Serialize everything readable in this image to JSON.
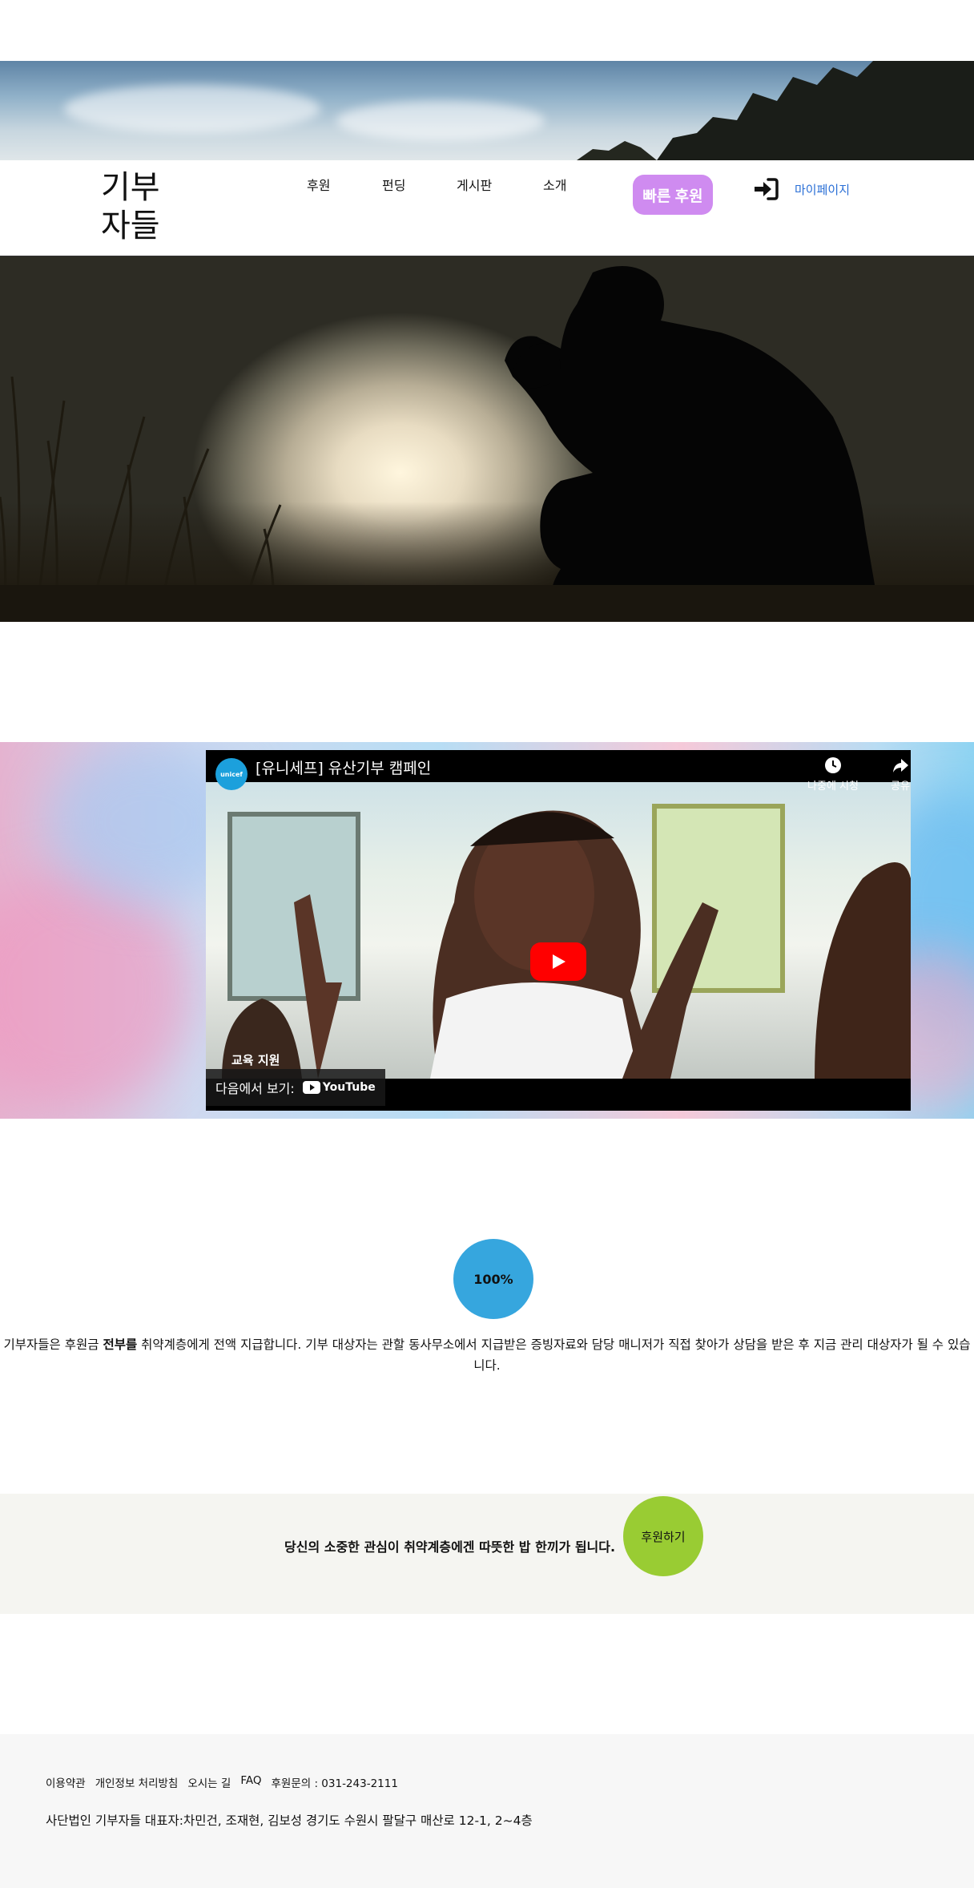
{
  "header": {
    "logo": "기부\n자들",
    "nav": [
      "후원",
      "펀딩",
      "게시판",
      "소개"
    ],
    "quick_donate": "빠른 후원",
    "mypage": "마이페이지"
  },
  "video": {
    "title": "[유니세프] 유산기부 캠페인",
    "channel_logo_text": "unicef",
    "watch_later": "나중에 시청",
    "share": "공유",
    "caption": "교육 지원",
    "watch_on": "다음에서 보기:",
    "youtube": "YouTube"
  },
  "stats": {
    "percent": "100%",
    "desc_before": "기부자들은 후원금 ",
    "desc_bold": "전부를",
    "desc_after": " 취약계층에게 전액 지급합니다. 기부 대상자는 관할 동사무소에서 지급받은 증빙자료와 담당 매니저가 직접 찾아가 상담을 받은 후 지금 관리 대상자가 될 수 있습니다."
  },
  "cta": {
    "text": "당신의 소중한 관심이 취약계층에겐 따뜻한 밥 한끼가 됩니다.",
    "button": "후원하기"
  },
  "footer": {
    "links": [
      "이용약관",
      "개인정보 처리방침",
      "오시는 길",
      "FAQ",
      "후원문의 : 031-243-2111"
    ],
    "info": "사단법인 기부자들  대표자:차민건, 조재현, 김보성  경기도 수원시 팔달구 매산로 12-1, 2~4층"
  },
  "colors": {
    "quick_button": "#cf8bf0",
    "mypage_link": "#2a6fd6",
    "percent_circle": "#36a6de",
    "cta_button": "#99cc33",
    "youtube_red": "#ff0000"
  }
}
